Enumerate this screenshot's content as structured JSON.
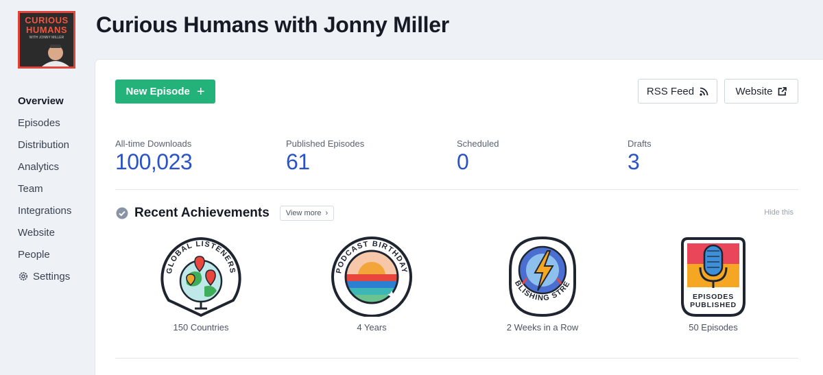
{
  "podcast": {
    "title": "Curious Humans with Jonny Miller",
    "cover_line1": "CURIOUS",
    "cover_line2": "HUMANS",
    "cover_sub": "WITH JONNY MILLER"
  },
  "sidebar": {
    "items": [
      {
        "label": "Overview",
        "active": true
      },
      {
        "label": "Episodes"
      },
      {
        "label": "Distribution"
      },
      {
        "label": "Analytics"
      },
      {
        "label": "Team"
      },
      {
        "label": "Integrations"
      },
      {
        "label": "Website"
      },
      {
        "label": "People"
      },
      {
        "label": "Settings",
        "icon": "gear-icon"
      }
    ]
  },
  "toolbar": {
    "new_episode_label": "New Episode",
    "rss_label": "RSS Feed",
    "website_label": "Website"
  },
  "stats": [
    {
      "label": "All-time Downloads",
      "value": "100,023"
    },
    {
      "label": "Published Episodes",
      "value": "61"
    },
    {
      "label": "Scheduled",
      "value": "0"
    },
    {
      "label": "Drafts",
      "value": "3"
    }
  ],
  "achievements": {
    "title": "Recent Achievements",
    "view_more_label": "View more",
    "hide_label": "Hide this",
    "badges": [
      {
        "badge_text": "GLOBAL LISTENERS",
        "caption": "150 Countries",
        "icon": "globe-badge-icon"
      },
      {
        "badge_text": "PODCAST BIRTHDAY",
        "caption": "4 Years",
        "icon": "sunset-badge-icon"
      },
      {
        "badge_text": "PUBLISHING STREAK",
        "caption": "2 Weeks in a Row",
        "icon": "lightning-badge-icon"
      },
      {
        "badge_text_line1": "EPISODES",
        "badge_text_line2": "PUBLISHED",
        "caption": "50 Episodes",
        "icon": "microphone-badge-icon"
      }
    ]
  },
  "colors": {
    "accent_green": "#22b27a",
    "stat_blue": "#2a52c9",
    "cover_red": "#e0443a"
  }
}
